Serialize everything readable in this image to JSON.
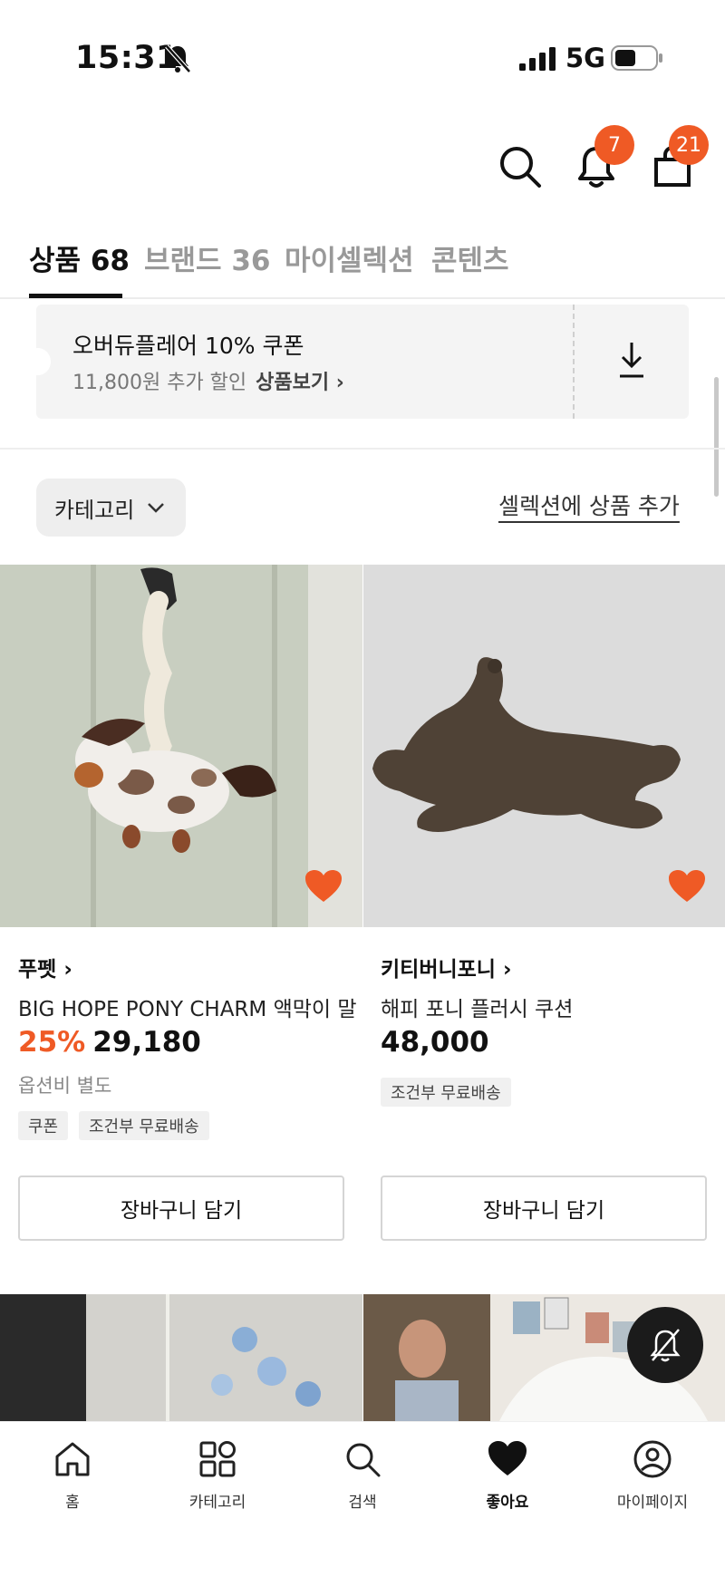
{
  "status_bar": {
    "time": "15:31",
    "network": "5G"
  },
  "header": {
    "notification_count": "7",
    "cart_count": "21"
  },
  "tabs": [
    {
      "label": "상품 68"
    },
    {
      "label": "브랜드 36"
    },
    {
      "label": "마이셀렉션"
    },
    {
      "label": "콘텐츠"
    }
  ],
  "coupon": {
    "title": "오버듀플레어 10% 쿠폰",
    "discount_text": "11,800원 추가 할인",
    "link_label": "상품보기 ›"
  },
  "filter": {
    "category_label": "카테고리",
    "add_to_selection": "셀렉션에 상품 추가"
  },
  "products": [
    {
      "brand": "푸펫 ›",
      "name": "BIG HOPE PONY CHARM 액막이 말",
      "discount": "25%",
      "price": "29,180",
      "option_note": "옵션비 별도",
      "tags": [
        "쿠폰",
        "조건부 무료배송"
      ],
      "cart_label": "장바구니 담기",
      "liked": true
    },
    {
      "brand": "키티버니포니 ›",
      "name": "해피 포니 플러시 쿠션",
      "price": "48,000",
      "tags": [
        "조건부 무료배송"
      ],
      "cart_label": "장바구니 담기",
      "liked": true
    }
  ],
  "bottom_nav": [
    {
      "label": "홈",
      "icon": "home-icon"
    },
    {
      "label": "카테고리",
      "icon": "grid-icon"
    },
    {
      "label": "검색",
      "icon": "search-icon"
    },
    {
      "label": "좋아요",
      "icon": "heart-icon",
      "active": true
    },
    {
      "label": "마이페이지",
      "icon": "user-icon"
    }
  ],
  "colors": {
    "accent": "#ef5a25",
    "text": "#111111",
    "muted": "#999999"
  }
}
